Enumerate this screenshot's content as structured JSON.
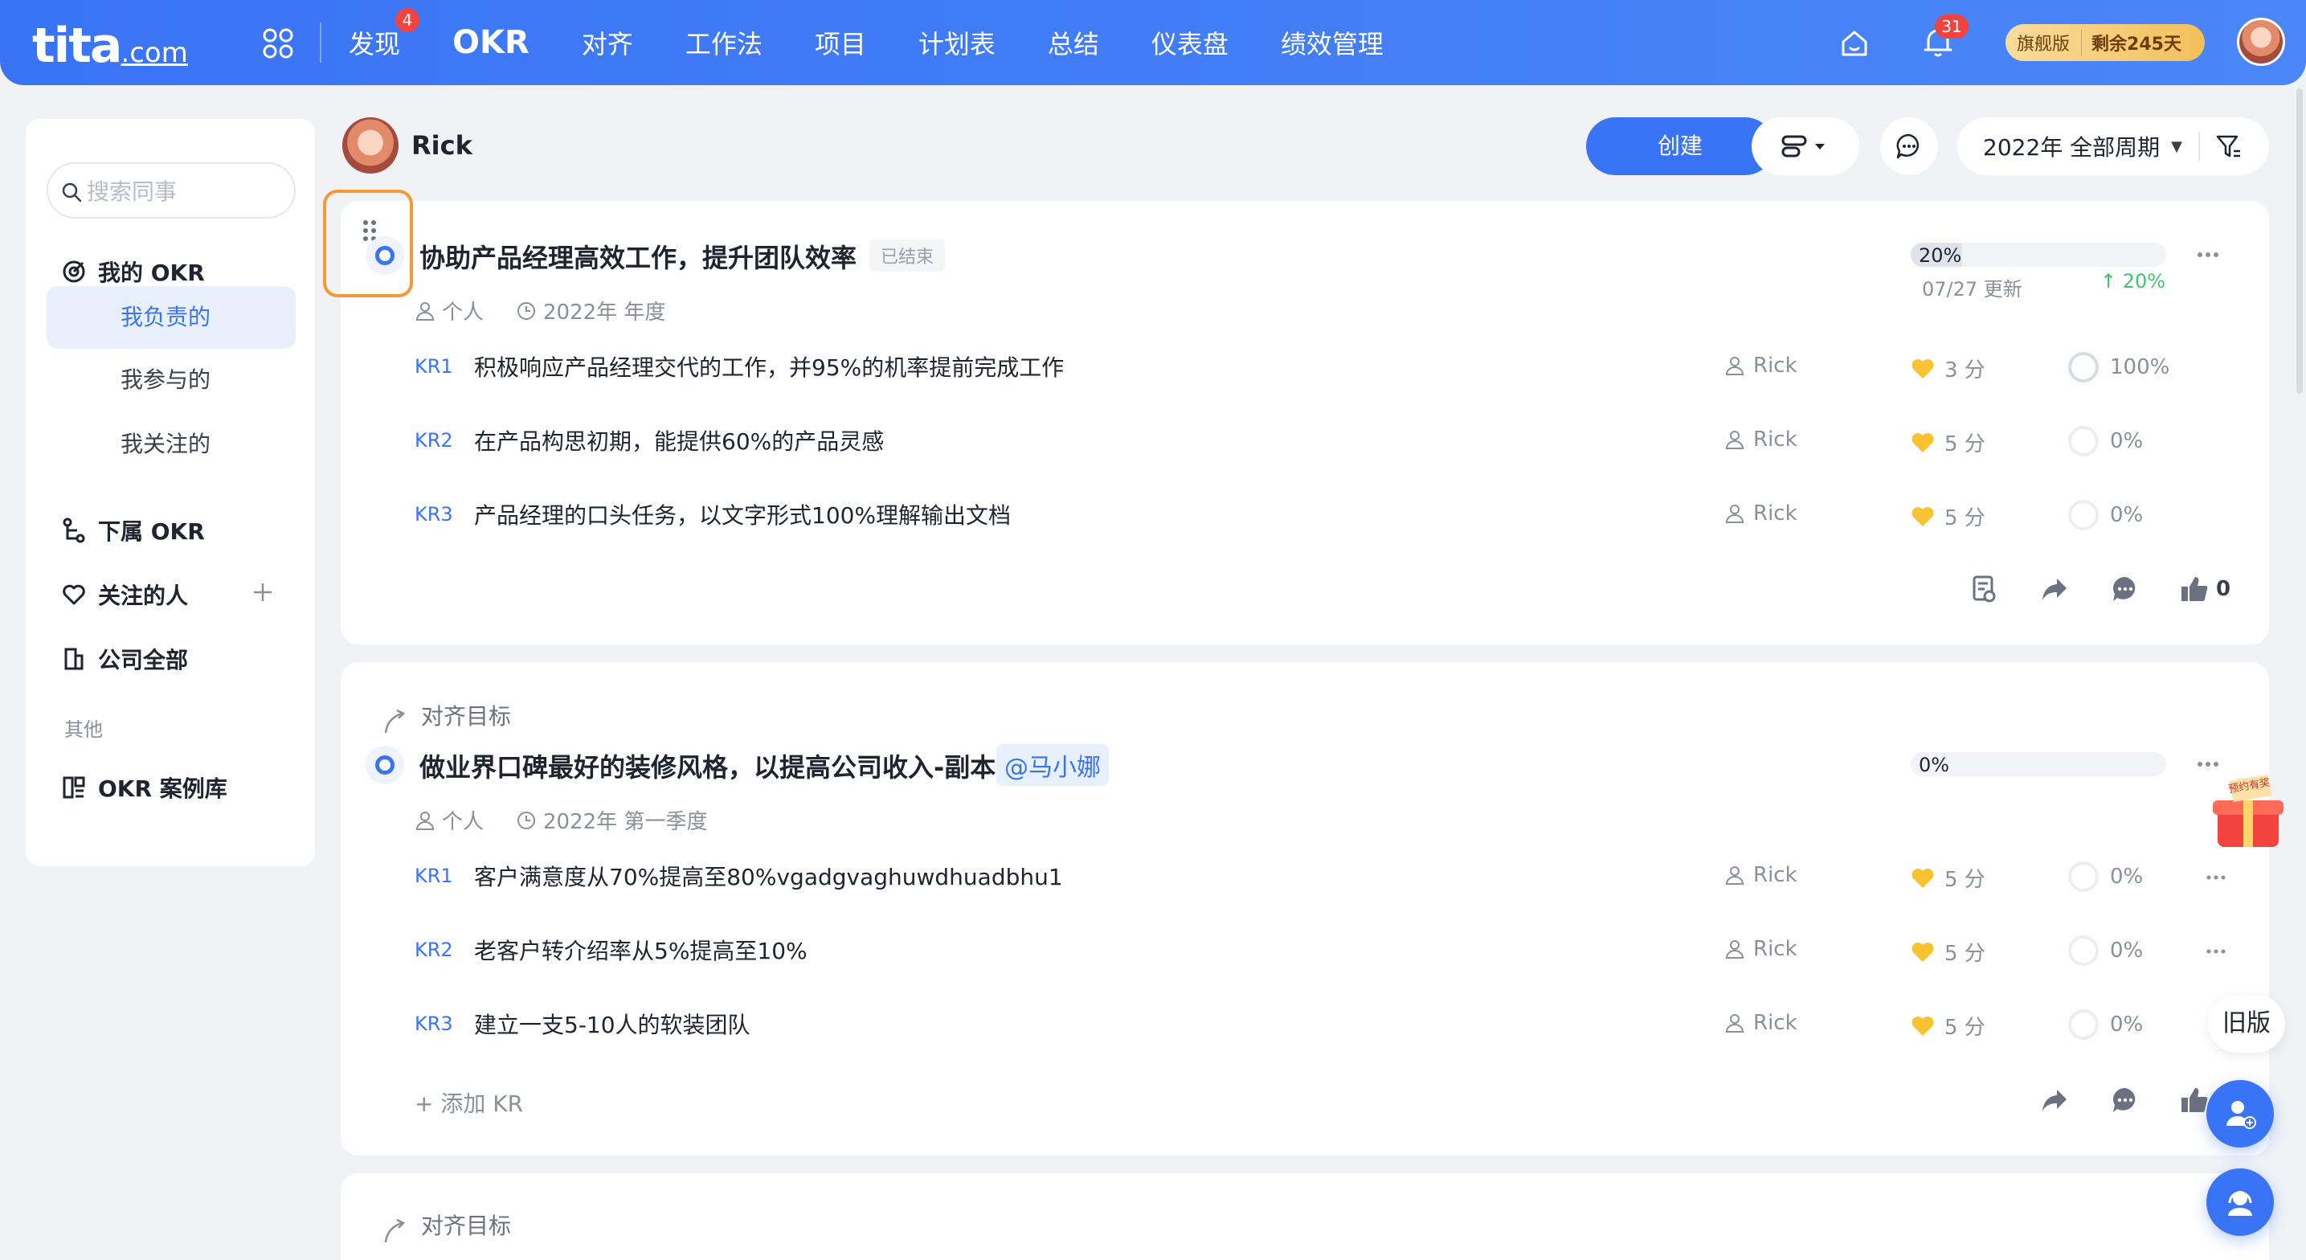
{
  "brand": {
    "logo_main": "tita",
    "logo_suffix": ".com"
  },
  "nav": {
    "items": [
      {
        "label": "发现",
        "badge": "4"
      },
      {
        "label": "OKR",
        "active": true
      },
      {
        "label": "对齐"
      },
      {
        "label": "工作法"
      },
      {
        "label": "项目"
      },
      {
        "label": "计划表"
      },
      {
        "label": "总结"
      },
      {
        "label": "仪表盘"
      },
      {
        "label": "绩效管理"
      }
    ],
    "bell_badge": "31",
    "plan_name": "旗舰版",
    "plan_remaining": "剩余245天"
  },
  "sidebar": {
    "search_placeholder": "搜索同事",
    "my_okr": "我的 OKR",
    "sub_items": [
      "我负责的",
      "我参与的",
      "我关注的"
    ],
    "subordinate_okr": "下属 OKR",
    "followed_people": "关注的人",
    "company_all": "公司全部",
    "group_other": "其他",
    "okr_library": "OKR 案例库"
  },
  "header": {
    "user_name": "Rick",
    "create_label": "创建",
    "period_label": "2022年 全部周期"
  },
  "objectives": [
    {
      "title": "协助产品经理高效工作，提升团队效率",
      "status_tag": "已结束",
      "type": "个人",
      "period": "2022年 年度",
      "progress_text": "20%",
      "progress": 0.2,
      "updated": "07/27 更新",
      "delta": "↑ 20%",
      "krs": [
        {
          "id": "KR1",
          "text": "积极响应产品经理交代的工作，并95%的机率提前完成工作",
          "owner": "Rick",
          "score": "3 分",
          "progress": "100%"
        },
        {
          "id": "KR2",
          "text": "在产品构思初期，能提供60%的产品灵感",
          "owner": "Rick",
          "score": "5 分",
          "progress": "0%"
        },
        {
          "id": "KR3",
          "text": "产品经理的口头任务，以文字形式100%理解输出文档",
          "owner": "Rick",
          "score": "5 分",
          "progress": "0%"
        }
      ],
      "like_count": "0"
    },
    {
      "align_label": "对齐目标",
      "title": "做业界口碑最好的装修风格，以提高公司收入-副本",
      "mention": "@马小娜",
      "type": "个人",
      "period": "2022年 第一季度",
      "progress_text": "0%",
      "progress": 0,
      "krs": [
        {
          "id": "KR1",
          "text": "客户满意度从70%提高至80%vgadgvaghuwdhuadbhu1",
          "owner": "Rick",
          "score": "5 分",
          "progress": "0%"
        },
        {
          "id": "KR2",
          "text": "老客户转介绍率从5%提高至10%",
          "owner": "Rick",
          "score": "5 分",
          "progress": "0%"
        },
        {
          "id": "KR3",
          "text": "建立一支5-10人的软装团队",
          "owner": "Rick",
          "score": "5 分",
          "progress": "0%"
        }
      ],
      "add_kr": "+ 添加 KR"
    },
    {
      "align_label": "对齐目标"
    }
  ],
  "floating": {
    "gift_text": "预约有奖",
    "old_version": "旧版"
  },
  "colors": {
    "brand_blue": "#3a74f6",
    "highlight_orange": "#f59a33",
    "delta_green": "#43c46b"
  }
}
